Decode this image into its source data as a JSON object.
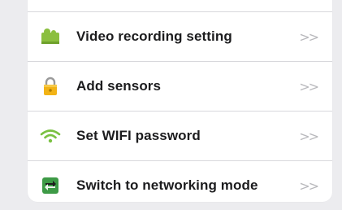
{
  "menu": {
    "items": [
      {
        "label": "Video recording setting",
        "icon": "video-camera-icon",
        "chevron": ">>",
        "icon_color": "#8bbf3f"
      },
      {
        "label": "Add sensors",
        "icon": "lock-icon",
        "chevron": ">>",
        "icon_color": "#f2b316"
      },
      {
        "label": "Set WIFI password",
        "icon": "wifi-icon",
        "chevron": ">>",
        "icon_color": "#7ac142"
      },
      {
        "label": "Switch to networking mode",
        "icon": "switch-arrows-icon",
        "chevron": ">>",
        "icon_color": "#4caf50"
      }
    ]
  }
}
